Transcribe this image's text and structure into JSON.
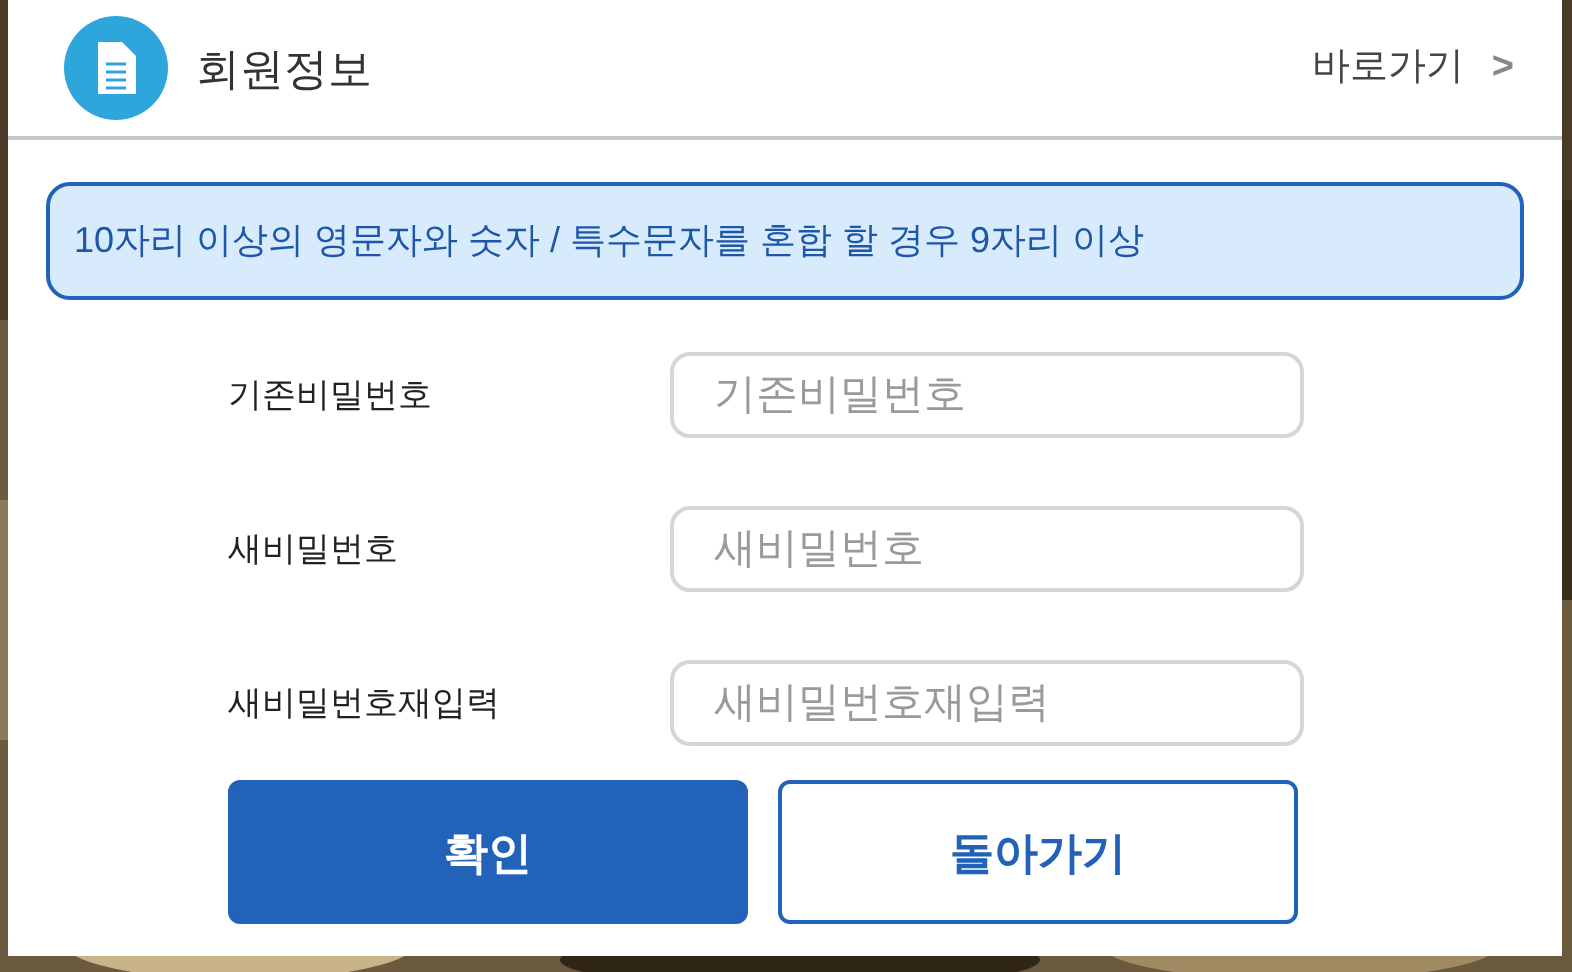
{
  "header": {
    "title": "회원정보",
    "link": "바로가기",
    "link_arrow": ">"
  },
  "notice": "10자리 이상의 영문자와 숫자 / 특수문자를 혼합 할 경우 9자리 이상",
  "fields": [
    {
      "label": "기존비밀번호",
      "placeholder": "기존비밀번호"
    },
    {
      "label": "새비밀번호",
      "placeholder": "새비밀번호"
    },
    {
      "label": "새비밀번호재입력",
      "placeholder": "새비밀번호재입력"
    }
  ],
  "buttons": [
    {
      "label": "확인",
      "kind": "primary"
    },
    {
      "label": "돌아가기",
      "kind": "secondary"
    }
  ]
}
